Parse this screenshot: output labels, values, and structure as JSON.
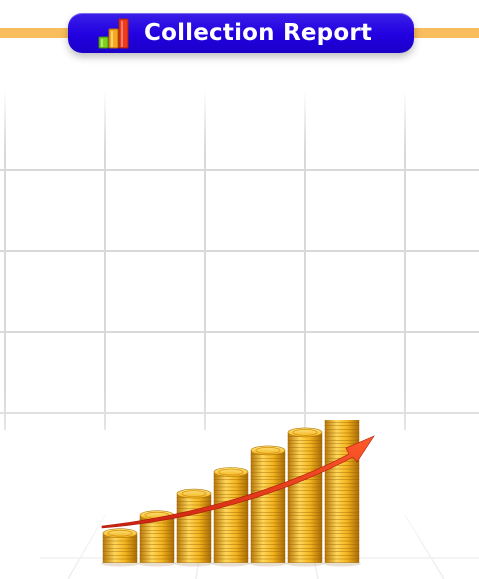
{
  "header": {
    "title": "Collection Report",
    "icon": "bar-chart-icon"
  },
  "illustration": {
    "name": "coin-growth-illustration",
    "coin_stack_levels": [
      1,
      2,
      3,
      4,
      5,
      6,
      7
    ],
    "coin_color": "#f2b21d",
    "arrow_color": "#e23a18"
  },
  "colors": {
    "pill": "#2200e0",
    "bar": "#f8bd5d",
    "grid": "#d8d8d8"
  }
}
